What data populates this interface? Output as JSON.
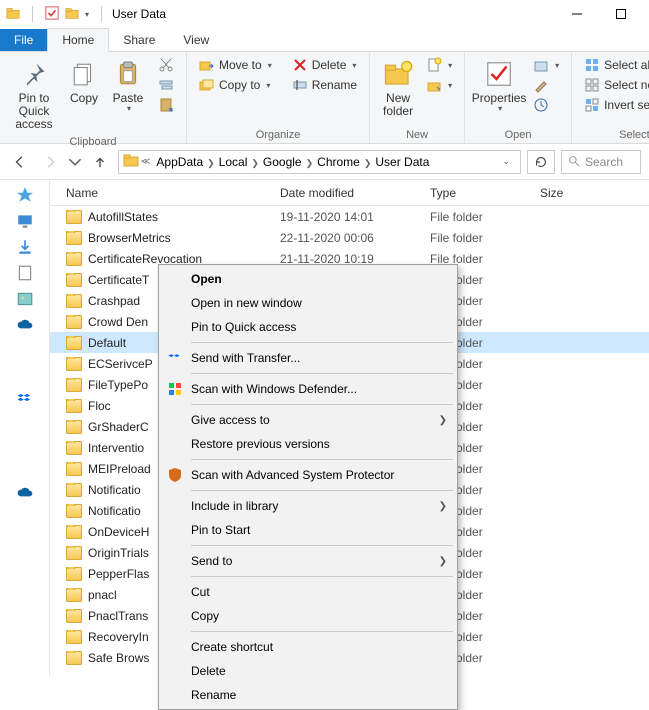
{
  "title": "User Data",
  "tabs": {
    "file": "File",
    "home": "Home",
    "share": "Share",
    "view": "View"
  },
  "ribbon": {
    "clipboard": {
      "label": "Clipboard",
      "pin": "Pin to Quick access",
      "copy": "Copy",
      "paste": "Paste"
    },
    "organize": {
      "label": "Organize",
      "move": "Move to",
      "copy": "Copy to",
      "delete": "Delete",
      "rename": "Rename"
    },
    "new": {
      "label": "New",
      "folder": "New folder"
    },
    "open": {
      "label": "Open",
      "properties": "Properties"
    },
    "select": {
      "label": "Select",
      "all": "Select all",
      "none": "Select none",
      "invert": "Invert selection"
    }
  },
  "breadcrumbs": [
    "AppData",
    "Local",
    "Google",
    "Chrome",
    "User Data"
  ],
  "search_placeholder": "Search",
  "columns": {
    "name": "Name",
    "date": "Date modified",
    "type": "Type",
    "size": "Size"
  },
  "file_type": "File folder",
  "rows": [
    {
      "name": "AutofillStates",
      "date": "19-11-2020 14:01"
    },
    {
      "name": "BrowserMetrics",
      "date": "22-11-2020 00:06"
    },
    {
      "name": "CertificateRevocation",
      "date": "21-11-2020 10:19"
    },
    {
      "name": "CertificateTransparency",
      "date": ""
    },
    {
      "name": "Crashpad",
      "date": ""
    },
    {
      "name": "Crowd Deny",
      "date": ""
    },
    {
      "name": "Default",
      "date": "",
      "selected": true
    },
    {
      "name": "ECSerivcePack",
      "date": ""
    },
    {
      "name": "FileTypePolicies",
      "date": ""
    },
    {
      "name": "Floc",
      "date": ""
    },
    {
      "name": "GrShaderCache",
      "date": ""
    },
    {
      "name": "InterventionPolicyDatabase",
      "date": ""
    },
    {
      "name": "MEIPreload",
      "date": ""
    },
    {
      "name": "NotificationPlatform",
      "date": ""
    },
    {
      "name": "NotificationResources",
      "date": ""
    },
    {
      "name": "OnDeviceHeadSuggestModel",
      "date": ""
    },
    {
      "name": "OriginTrials",
      "date": ""
    },
    {
      "name": "PepperFlash",
      "date": ""
    },
    {
      "name": "pnacl",
      "date": ""
    },
    {
      "name": "PnaclTranslationCache",
      "date": ""
    },
    {
      "name": "RecoveryImproved",
      "date": ""
    },
    {
      "name": "Safe Browsing",
      "date": ""
    }
  ],
  "trunc": {
    "3": "CertificateT",
    "4": "Crashpad",
    "5": "Crowd Den",
    "7": "ECSerivceP",
    "8": "FileTypePo",
    "9": "Floc",
    "10": "GrShaderC",
    "11": "Interventio",
    "12": "MEIPreload",
    "13": "Notificatio",
    "14": "Notificatio",
    "15": "OnDeviceH",
    "16": "OriginTrials",
    "17": "PepperFlas",
    "18": "pnacl",
    "19": "PnaclTrans",
    "20": "RecoveryIn",
    "21": "Safe Brows"
  },
  "context_menu": {
    "open": "Open",
    "open_new": "Open in new window",
    "pin": "Pin to Quick access",
    "send_transfer": "Send with Transfer...",
    "defender": "Scan with Windows Defender...",
    "give_access": "Give access to",
    "restore": "Restore previous versions",
    "asp": "Scan with Advanced System Protector",
    "include": "Include in library",
    "pin_start": "Pin to Start",
    "send_to": "Send to",
    "cut": "Cut",
    "copy": "Copy",
    "shortcut": "Create shortcut",
    "delete": "Delete",
    "rename": "Rename"
  }
}
